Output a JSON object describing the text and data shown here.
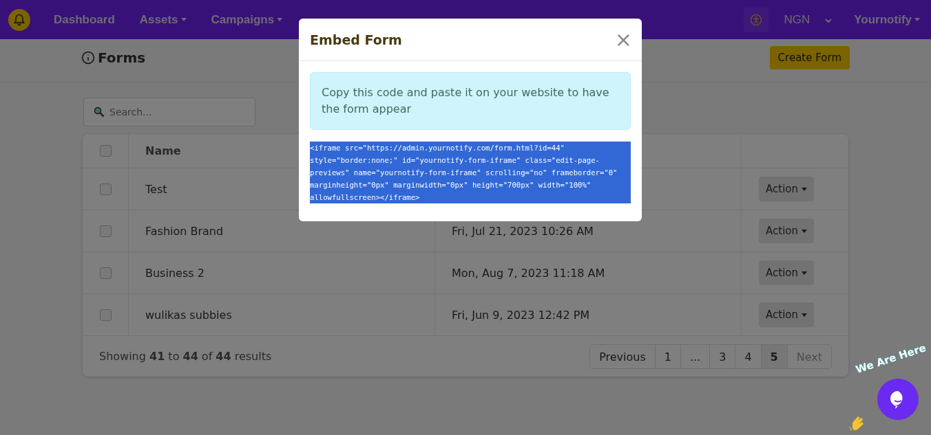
{
  "nav": {
    "items": [
      {
        "label": "Dashboard",
        "dropdown": false
      },
      {
        "label": "Assets",
        "dropdown": true
      },
      {
        "label": "Campaigns",
        "dropdown": true
      }
    ],
    "currency": "NGN",
    "account": "Yournotify"
  },
  "page": {
    "title": "Forms",
    "create_button": "Create Form"
  },
  "search": {
    "placeholder": "Search..."
  },
  "table": {
    "columns": [
      "Name"
    ],
    "header_checked": false,
    "rows": [
      {
        "name": "Test",
        "checked": false,
        "action": "Action"
      },
      {
        "name": "Fashion Brand",
        "date": "Fri, Jul 21, 2023 10:26 AM",
        "checked": false,
        "action": "Action"
      },
      {
        "name": "Business 2",
        "date": "Mon, Aug 7, 2023 11:18 AM",
        "checked": false,
        "action": "Action"
      },
      {
        "name": "wulikas subbies",
        "date": "Fri, Jun 9, 2023 12:42 PM",
        "checked": false,
        "action": "Action"
      }
    ],
    "summary": "Showing **41** to **44** of **44** results",
    "pagination": [
      {
        "label": "Previous",
        "selected": false,
        "disabled": false
      },
      {
        "label": "1",
        "selected": false,
        "disabled": false
      },
      {
        "label": "...",
        "selected": false,
        "disabled": false
      },
      {
        "label": "3",
        "selected": false,
        "disabled": false
      },
      {
        "label": "4",
        "selected": false,
        "disabled": false
      },
      {
        "label": "5",
        "selected": true,
        "disabled": false
      },
      {
        "label": "Next",
        "selected": false,
        "disabled": true
      }
    ]
  },
  "modal": {
    "title": "Embed Form",
    "close": "×",
    "alert": "Copy this code and paste it on your website to have the form appear",
    "code": "<iframe src=\"https://admin.yournotify.com/form.html?id=44\" style=\"border:none;\" id=\"yournotify-form-iframe\" class=\"edit-page-previews\" name=\"yournotify-form-iframe\" scrolling=\"no\" frameborder=\"0\" marginheight=\"0px\" marginwidth=\"0px\" height=\"700px\" width=\"100%\" allowfullscreen></iframe>",
    "code_selected": true
  },
  "chat": {
    "label": "We Are Here"
  }
}
